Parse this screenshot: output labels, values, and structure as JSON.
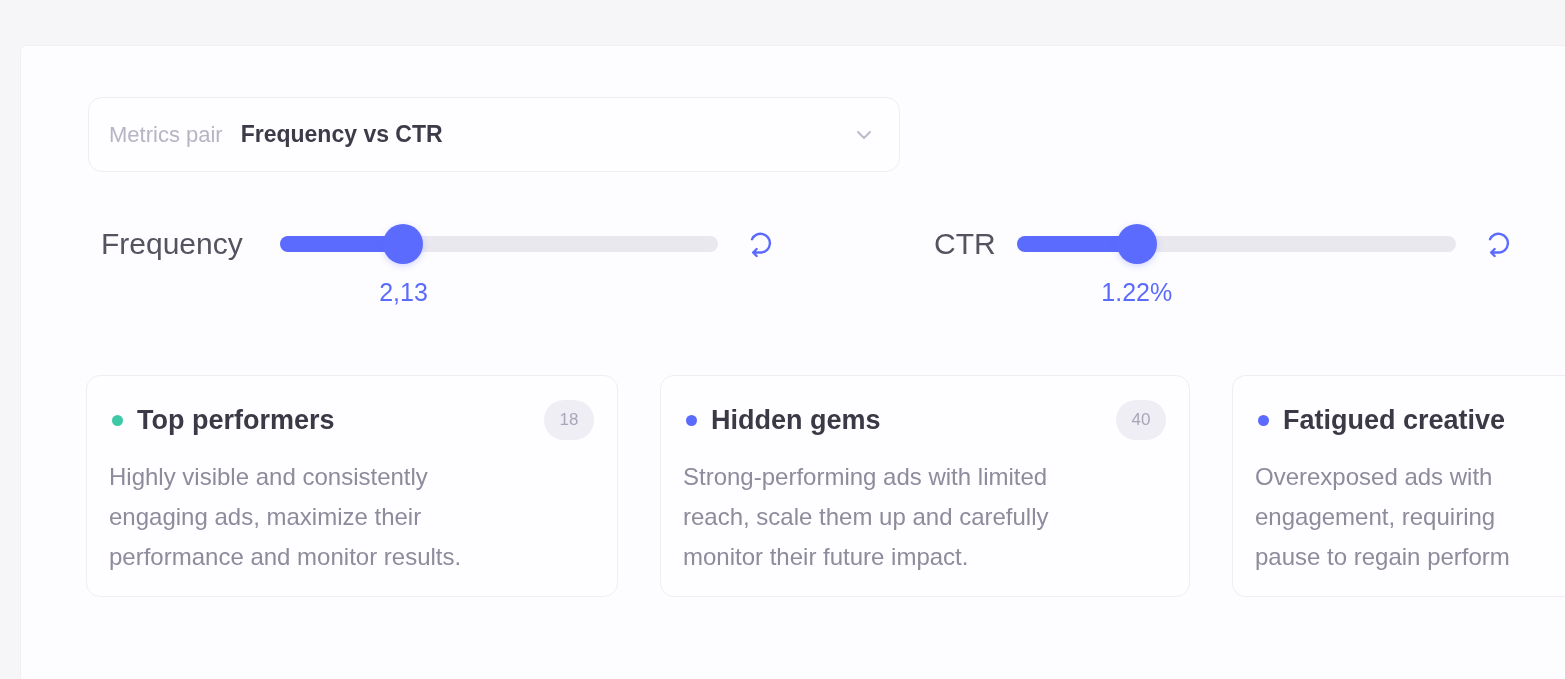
{
  "selector": {
    "label": "Metrics pair",
    "value": "Frequency vs CTR"
  },
  "sliders": [
    {
      "label": "Frequency",
      "level": 0.26,
      "reading": "2,13"
    },
    {
      "label": "CTR",
      "level": 0.25,
      "reading": "1.22%"
    }
  ],
  "segments": [
    {
      "title": "Top performers",
      "count": "18",
      "color": "#3ec9a6",
      "description_lines": [
        "Highly visible and consistently",
        "engaging ads, maximize their",
        "performance and monitor results."
      ]
    },
    {
      "title": "Hidden gems",
      "count": "40",
      "color": "#5b6bfe",
      "description_lines": [
        "Strong-performing ads with limited",
        "reach, scale them up and carefully",
        "monitor their future impact."
      ]
    },
    {
      "title": "Fatigued creative",
      "color": "#5b6bfe",
      "description_lines": [
        "Overexposed ads with",
        "engagement, requiring",
        "pause to regain perform"
      ]
    }
  ]
}
